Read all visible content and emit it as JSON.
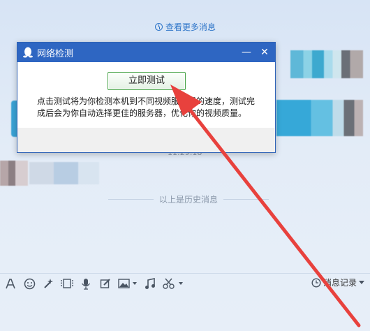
{
  "chat": {
    "more_messages": "查看更多消息",
    "timestamp": "11:29:18",
    "history_divider": "以上是历史消息"
  },
  "dialog": {
    "title": "网络检测",
    "minimize_label": "—",
    "close_label": "✕",
    "test_button": "立即测试",
    "description": "点击测试将为你检测本机到不同视频服务器的速度，测试完成后会为你自动选择更佳的服务器，优化你的视频质量。"
  },
  "toolbar": {
    "icons": [
      "font-icon",
      "emoji-icon",
      "magic-icon",
      "video-icon",
      "mic-icon",
      "edit-icon",
      "image-icon",
      "music-icon",
      "scissors-icon"
    ],
    "message_history": "消息记录"
  },
  "colors": {
    "titlebar": "#2e66c2",
    "annotation_arrow": "#e8413d"
  }
}
